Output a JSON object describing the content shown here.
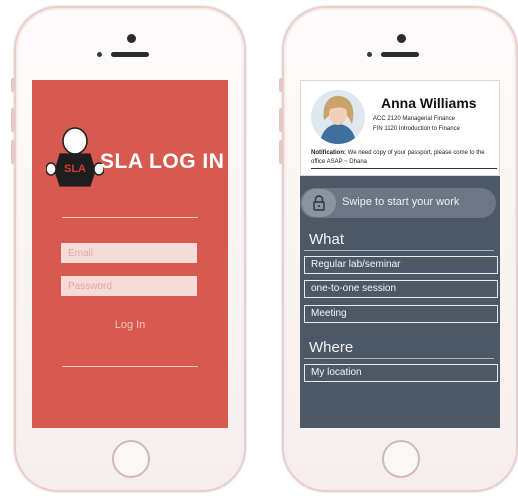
{
  "login": {
    "title": "SLA LOG IN",
    "mascot_badge": "SLA",
    "email_placeholder": "Email",
    "password_placeholder": "Password",
    "login_button": "Log In"
  },
  "profile": {
    "name": "Anna Williams",
    "courses": [
      "ACC 2120 Managerial Finance",
      "FIN 1120 Introduction to Finance"
    ],
    "notification_label": "Notification:",
    "notification_text": "We need copy of your passport, please come to the office ASAP ~ Dhana"
  },
  "swipe": {
    "label": "Swipe to start your work",
    "icon": "lock-icon"
  },
  "what": {
    "heading": "What",
    "options": [
      "Regular lab/seminar",
      "one-to-one session",
      "Meeting"
    ]
  },
  "where": {
    "heading": "Where",
    "options": [
      "My location"
    ]
  },
  "colors": {
    "login_bg": "#d65a4f",
    "app_bg": "#4d5866",
    "phone_frame": "#e7cfcb"
  }
}
